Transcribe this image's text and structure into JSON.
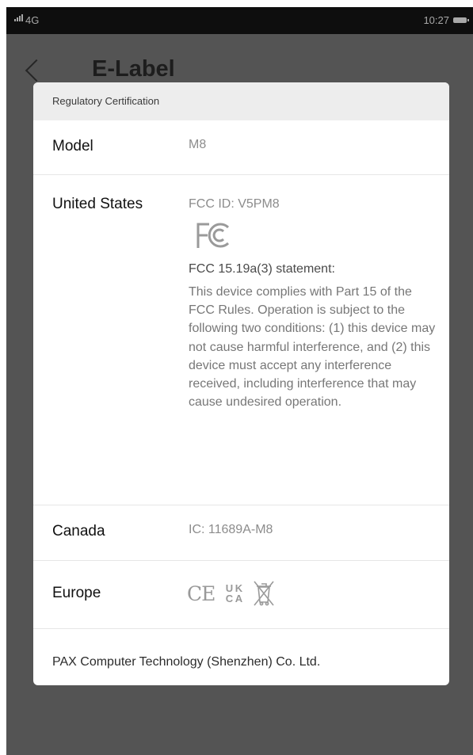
{
  "status_bar": {
    "network": "4G",
    "time": "10:27"
  },
  "app_bar": {
    "title": "E-Label"
  },
  "card": {
    "header": "Regulatory Certification",
    "rows": [
      {
        "label": "Model",
        "value": "M8"
      },
      {
        "label": "United States",
        "value": "FCC ID: V5PM8",
        "logo": "FCC",
        "statement_title": "FCC 15.19a(3) statement:",
        "statement": "This device complies with Part 15 of the FCC Rules. Operation is subject to the following two conditions: (1) this device may not cause harmful interference, and (2) this device must accept any interference received, including interference that may cause undesired operation."
      },
      {
        "label": "Canada",
        "value": "IC: 11689A-M8"
      },
      {
        "label": "Europe",
        "marks": [
          "CE",
          "UKCA",
          "WEEE"
        ]
      }
    ],
    "footer": "PAX Computer Technology (Shenzhen) Co. Ltd."
  },
  "colors": {
    "overlay": "#545454",
    "status_bar": "#0e0e0e",
    "card": "#ffffff",
    "card_header": "#ededed"
  }
}
